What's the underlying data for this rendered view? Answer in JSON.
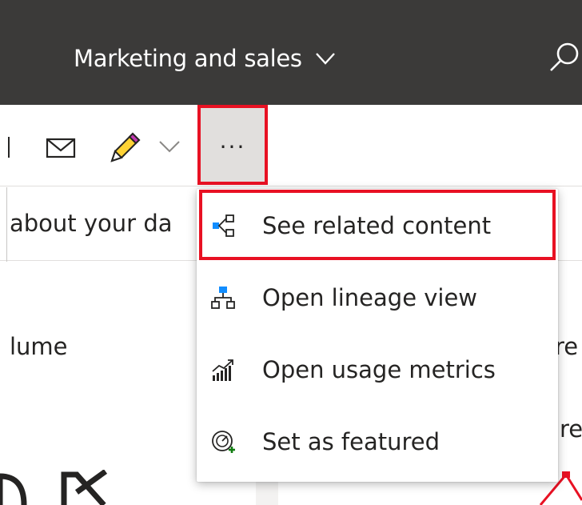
{
  "header": {
    "workspace_title": "Marketing and sales",
    "title_chevron_icon": "chevron-down-icon",
    "search_icon": "search-icon"
  },
  "toolbar": {
    "mail_icon": "mail-icon",
    "edit_icon": "pencil-icon",
    "edit_chevron_icon": "chevron-down-icon",
    "more_label": "...",
    "more_icon": "more-options-icon"
  },
  "qa": {
    "text": "about your da"
  },
  "tiles": {
    "left_title": "lume",
    "left_big_value": "",
    "right_line1": "re",
    "right_line2": "re"
  },
  "menu": {
    "items": [
      {
        "label": "See related content",
        "icon": "related-content-icon"
      },
      {
        "label": "Open lineage view",
        "icon": "lineage-icon"
      },
      {
        "label": "Open usage metrics",
        "icon": "usage-metrics-icon"
      },
      {
        "label": "Set as featured",
        "icon": "featured-icon"
      }
    ]
  },
  "colors": {
    "header_bg": "#3b3a39",
    "highlight_red": "#e81123",
    "more_button_bg": "#e1dfdd",
    "accent_blue": "#118dff",
    "accent_green": "#107c10"
  }
}
